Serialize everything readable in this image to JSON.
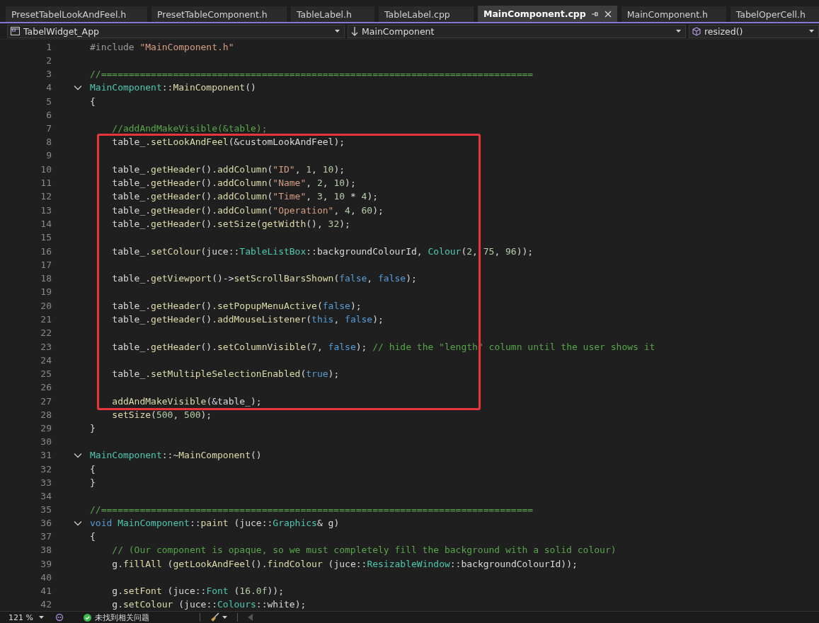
{
  "tabs": [
    {
      "label": "PresetTabelLookAndFeel.h",
      "selected": false
    },
    {
      "label": "PresetTableComponent.h",
      "selected": false
    },
    {
      "label": "TableLabel.h",
      "selected": false
    },
    {
      "label": "TableLabel.cpp",
      "selected": false
    },
    {
      "label": "MainComponent.cpp",
      "selected": true
    },
    {
      "label": "MainComponent.h",
      "selected": false
    },
    {
      "label": "TabelOperCell.h",
      "selected": false
    }
  ],
  "navigation_bar": {
    "project": "TabelWidget_App",
    "scope": "MainComponent",
    "member": "resized()"
  },
  "code_lines": [
    {
      "number": "1",
      "foldable": false,
      "boxed": false,
      "segments": [
        {
          "kind": "macro",
          "text": "#include "
        },
        {
          "kind": "string",
          "text": "\"MainComponent.h\""
        }
      ]
    },
    {
      "number": "2",
      "foldable": false,
      "boxed": false
    },
    {
      "number": "3",
      "foldable": false,
      "boxed": false,
      "segments": [
        {
          "kind": "comment",
          "text": "//=============================================================================="
        }
      ]
    },
    {
      "number": "4",
      "foldable": true,
      "expanded": true,
      "boxed": false,
      "segments": [
        {
          "kind": "type",
          "text": "MainComponent"
        },
        {
          "kind": "plain",
          "text": "::"
        },
        {
          "kind": "function",
          "text": "MainComponent"
        },
        {
          "kind": "plain",
          "text": "()"
        }
      ]
    },
    {
      "number": "5",
      "foldable": false,
      "boxed": false,
      "segments": [
        {
          "kind": "plain",
          "text": "{"
        }
      ]
    },
    {
      "number": "6",
      "foldable": false,
      "boxed": false
    },
    {
      "number": "7",
      "foldable": false,
      "boxed": false,
      "segments": [
        {
          "kind": "comment",
          "text": "    //addAndMakeVisible(&table);"
        }
      ]
    },
    {
      "number": "8",
      "foldable": false,
      "boxed": true,
      "segments": [
        {
          "kind": "plain",
          "text": "    table_."
        },
        {
          "kind": "function",
          "text": "setLookAndFeel"
        },
        {
          "kind": "plain",
          "text": "(&customLookAndFeel);"
        }
      ]
    },
    {
      "number": "9",
      "foldable": false,
      "boxed": true
    },
    {
      "number": "10",
      "foldable": false,
      "boxed": true,
      "segments": [
        {
          "kind": "plain",
          "text": "    table_."
        },
        {
          "kind": "function",
          "text": "getHeader"
        },
        {
          "kind": "plain",
          "text": "()."
        },
        {
          "kind": "function",
          "text": "addColumn"
        },
        {
          "kind": "plain",
          "text": "("
        },
        {
          "kind": "string",
          "text": "\"ID\""
        },
        {
          "kind": "plain",
          "text": ", "
        },
        {
          "kind": "number",
          "text": "1"
        },
        {
          "kind": "plain",
          "text": ", "
        },
        {
          "kind": "number",
          "text": "10"
        },
        {
          "kind": "plain",
          "text": ");"
        }
      ]
    },
    {
      "number": "11",
      "foldable": false,
      "boxed": true,
      "segments": [
        {
          "kind": "plain",
          "text": "    table_."
        },
        {
          "kind": "function",
          "text": "getHeader"
        },
        {
          "kind": "plain",
          "text": "()."
        },
        {
          "kind": "function",
          "text": "addColumn"
        },
        {
          "kind": "plain",
          "text": "("
        },
        {
          "kind": "string",
          "text": "\"Name\""
        },
        {
          "kind": "plain",
          "text": ", "
        },
        {
          "kind": "number",
          "text": "2"
        },
        {
          "kind": "plain",
          "text": ", "
        },
        {
          "kind": "number",
          "text": "10"
        },
        {
          "kind": "plain",
          "text": ");"
        }
      ]
    },
    {
      "number": "12",
      "foldable": false,
      "boxed": true,
      "segments": [
        {
          "kind": "plain",
          "text": "    table_."
        },
        {
          "kind": "function",
          "text": "getHeader"
        },
        {
          "kind": "plain",
          "text": "()."
        },
        {
          "kind": "function",
          "text": "addColumn"
        },
        {
          "kind": "plain",
          "text": "("
        },
        {
          "kind": "string",
          "text": "\"Time\""
        },
        {
          "kind": "plain",
          "text": ", "
        },
        {
          "kind": "number",
          "text": "3"
        },
        {
          "kind": "plain",
          "text": ", "
        },
        {
          "kind": "number",
          "text": "10"
        },
        {
          "kind": "plain",
          "text": " * "
        },
        {
          "kind": "number",
          "text": "4"
        },
        {
          "kind": "plain",
          "text": ");"
        }
      ]
    },
    {
      "number": "13",
      "foldable": false,
      "boxed": true,
      "segments": [
        {
          "kind": "plain",
          "text": "    table_."
        },
        {
          "kind": "function",
          "text": "getHeader"
        },
        {
          "kind": "plain",
          "text": "()."
        },
        {
          "kind": "function",
          "text": "addColumn"
        },
        {
          "kind": "plain",
          "text": "("
        },
        {
          "kind": "string",
          "text": "\"Operation\""
        },
        {
          "kind": "plain",
          "text": ", "
        },
        {
          "kind": "number",
          "text": "4"
        },
        {
          "kind": "plain",
          "text": ", "
        },
        {
          "kind": "number",
          "text": "60"
        },
        {
          "kind": "plain",
          "text": ");"
        }
      ]
    },
    {
      "number": "14",
      "foldable": false,
      "boxed": true,
      "segments": [
        {
          "kind": "plain",
          "text": "    table_."
        },
        {
          "kind": "function",
          "text": "getHeader"
        },
        {
          "kind": "plain",
          "text": "()."
        },
        {
          "kind": "function",
          "text": "setSize"
        },
        {
          "kind": "plain",
          "text": "("
        },
        {
          "kind": "function",
          "text": "getWidth"
        },
        {
          "kind": "plain",
          "text": "(), "
        },
        {
          "kind": "number",
          "text": "32"
        },
        {
          "kind": "plain",
          "text": ");"
        }
      ]
    },
    {
      "number": "15",
      "foldable": false,
      "boxed": true
    },
    {
      "number": "16",
      "foldable": false,
      "boxed": true,
      "segments": [
        {
          "kind": "plain",
          "text": "    table_."
        },
        {
          "kind": "function",
          "text": "setColour"
        },
        {
          "kind": "plain",
          "text": "(juce::"
        },
        {
          "kind": "type",
          "text": "TableListBox"
        },
        {
          "kind": "plain",
          "text": "::backgroundColourId, "
        },
        {
          "kind": "type",
          "text": "Colour"
        },
        {
          "kind": "plain",
          "text": "("
        },
        {
          "kind": "number",
          "text": "2"
        },
        {
          "kind": "plain",
          "text": ", "
        },
        {
          "kind": "number",
          "text": "75"
        },
        {
          "kind": "plain",
          "text": ", "
        },
        {
          "kind": "number",
          "text": "96"
        },
        {
          "kind": "plain",
          "text": "));"
        }
      ]
    },
    {
      "number": "17",
      "foldable": false,
      "boxed": true
    },
    {
      "number": "18",
      "foldable": false,
      "boxed": true,
      "segments": [
        {
          "kind": "plain",
          "text": "    table_."
        },
        {
          "kind": "function",
          "text": "getViewport"
        },
        {
          "kind": "plain",
          "text": "()->"
        },
        {
          "kind": "function",
          "text": "setScrollBarsShown"
        },
        {
          "kind": "plain",
          "text": "("
        },
        {
          "kind": "keyword",
          "text": "false"
        },
        {
          "kind": "plain",
          "text": ", "
        },
        {
          "kind": "keyword",
          "text": "false"
        },
        {
          "kind": "plain",
          "text": ");"
        }
      ]
    },
    {
      "number": "19",
      "foldable": false,
      "boxed": true
    },
    {
      "number": "20",
      "foldable": false,
      "boxed": true,
      "segments": [
        {
          "kind": "plain",
          "text": "    table_."
        },
        {
          "kind": "function",
          "text": "getHeader"
        },
        {
          "kind": "plain",
          "text": "()."
        },
        {
          "kind": "function",
          "text": "setPopupMenuActive"
        },
        {
          "kind": "plain",
          "text": "("
        },
        {
          "kind": "keyword",
          "text": "false"
        },
        {
          "kind": "plain",
          "text": ");"
        }
      ]
    },
    {
      "number": "21",
      "foldable": false,
      "boxed": true,
      "segments": [
        {
          "kind": "plain",
          "text": "    table_."
        },
        {
          "kind": "function",
          "text": "getHeader"
        },
        {
          "kind": "plain",
          "text": "()."
        },
        {
          "kind": "function",
          "text": "addMouseListener"
        },
        {
          "kind": "plain",
          "text": "("
        },
        {
          "kind": "keyword",
          "text": "this"
        },
        {
          "kind": "plain",
          "text": ", "
        },
        {
          "kind": "keyword",
          "text": "false"
        },
        {
          "kind": "plain",
          "text": ");"
        }
      ]
    },
    {
      "number": "22",
      "foldable": false,
      "boxed": true
    },
    {
      "number": "23",
      "foldable": false,
      "boxed": true,
      "segments": [
        {
          "kind": "plain",
          "text": "    table_."
        },
        {
          "kind": "function",
          "text": "getHeader"
        },
        {
          "kind": "plain",
          "text": "()."
        },
        {
          "kind": "function",
          "text": "setColumnVisible"
        },
        {
          "kind": "plain",
          "text": "("
        },
        {
          "kind": "number",
          "text": "7"
        },
        {
          "kind": "plain",
          "text": ", "
        },
        {
          "kind": "keyword",
          "text": "false"
        },
        {
          "kind": "plain",
          "text": "); "
        },
        {
          "kind": "comment",
          "text": "// hide the \"length\" column until the user shows it"
        }
      ]
    },
    {
      "number": "24",
      "foldable": false,
      "boxed": true
    },
    {
      "number": "25",
      "foldable": false,
      "boxed": true,
      "segments": [
        {
          "kind": "plain",
          "text": "    table_."
        },
        {
          "kind": "function",
          "text": "setMultipleSelectionEnabled"
        },
        {
          "kind": "plain",
          "text": "("
        },
        {
          "kind": "keyword",
          "text": "true"
        },
        {
          "kind": "plain",
          "text": ");"
        }
      ]
    },
    {
      "number": "26",
      "foldable": false,
      "boxed": true
    },
    {
      "number": "27",
      "foldable": false,
      "boxed": true,
      "segments": [
        {
          "kind": "function",
          "text": "    addAndMakeVisible"
        },
        {
          "kind": "plain",
          "text": "(&table_);"
        }
      ]
    },
    {
      "number": "28",
      "foldable": false,
      "boxed": false,
      "segments": [
        {
          "kind": "function",
          "text": "    setSize"
        },
        {
          "kind": "plain",
          "text": "("
        },
        {
          "kind": "number",
          "text": "500"
        },
        {
          "kind": "plain",
          "text": ", "
        },
        {
          "kind": "number",
          "text": "500"
        },
        {
          "kind": "plain",
          "text": ");"
        }
      ]
    },
    {
      "number": "29",
      "foldable": false,
      "boxed": false,
      "segments": [
        {
          "kind": "plain",
          "text": "}"
        }
      ]
    },
    {
      "number": "30",
      "foldable": false,
      "boxed": false
    },
    {
      "number": "31",
      "foldable": true,
      "expanded": true,
      "boxed": false,
      "segments": [
        {
          "kind": "type",
          "text": "MainComponent"
        },
        {
          "kind": "plain",
          "text": "::~"
        },
        {
          "kind": "function",
          "text": "MainComponent"
        },
        {
          "kind": "plain",
          "text": "()"
        }
      ]
    },
    {
      "number": "32",
      "foldable": false,
      "boxed": false,
      "segments": [
        {
          "kind": "plain",
          "text": "{"
        }
      ]
    },
    {
      "number": "33",
      "foldable": false,
      "boxed": false,
      "segments": [
        {
          "kind": "plain",
          "text": "}"
        }
      ]
    },
    {
      "number": "34",
      "foldable": false,
      "boxed": false
    },
    {
      "number": "35",
      "foldable": false,
      "boxed": false,
      "segments": [
        {
          "kind": "comment",
          "text": "//=============================================================================="
        }
      ]
    },
    {
      "number": "36",
      "foldable": true,
      "expanded": true,
      "boxed": false,
      "segments": [
        {
          "kind": "keyword",
          "text": "void "
        },
        {
          "kind": "type",
          "text": "MainComponent"
        },
        {
          "kind": "plain",
          "text": "::"
        },
        {
          "kind": "function",
          "text": "paint"
        },
        {
          "kind": "plain",
          "text": " (juce::"
        },
        {
          "kind": "type",
          "text": "Graphics"
        },
        {
          "kind": "plain",
          "text": "& g)"
        }
      ]
    },
    {
      "number": "37",
      "foldable": false,
      "boxed": false,
      "segments": [
        {
          "kind": "plain",
          "text": "{"
        }
      ]
    },
    {
      "number": "38",
      "foldable": false,
      "boxed": false,
      "segments": [
        {
          "kind": "comment",
          "text": "    // (Our component is opaque, so we must completely fill the background with a solid colour)"
        }
      ]
    },
    {
      "number": "39",
      "foldable": false,
      "boxed": false,
      "segments": [
        {
          "kind": "plain",
          "text": "    g."
        },
        {
          "kind": "function",
          "text": "fillAll"
        },
        {
          "kind": "plain",
          "text": " ("
        },
        {
          "kind": "function",
          "text": "getLookAndFeel"
        },
        {
          "kind": "plain",
          "text": "()."
        },
        {
          "kind": "function",
          "text": "findColour"
        },
        {
          "kind": "plain",
          "text": " (juce::"
        },
        {
          "kind": "type",
          "text": "ResizableWindow"
        },
        {
          "kind": "plain",
          "text": "::backgroundColourId));"
        }
      ]
    },
    {
      "number": "40",
      "foldable": false,
      "boxed": false
    },
    {
      "number": "41",
      "foldable": false,
      "boxed": false,
      "segments": [
        {
          "kind": "plain",
          "text": "    g."
        },
        {
          "kind": "function",
          "text": "setFont"
        },
        {
          "kind": "plain",
          "text": " (juce::"
        },
        {
          "kind": "type",
          "text": "Font"
        },
        {
          "kind": "plain",
          "text": " ("
        },
        {
          "kind": "number",
          "text": "16.0f"
        },
        {
          "kind": "plain",
          "text": "));"
        }
      ]
    },
    {
      "number": "42",
      "foldable": false,
      "boxed": false,
      "segments": [
        {
          "kind": "plain",
          "text": "    g."
        },
        {
          "kind": "function",
          "text": "setColour"
        },
        {
          "kind": "plain",
          "text": " (juce::"
        },
        {
          "kind": "type",
          "text": "Colours"
        },
        {
          "kind": "plain",
          "text": "::white);"
        }
      ]
    }
  ],
  "status_bar": {
    "zoom": "121 %",
    "issues": "未找到相关问题"
  }
}
